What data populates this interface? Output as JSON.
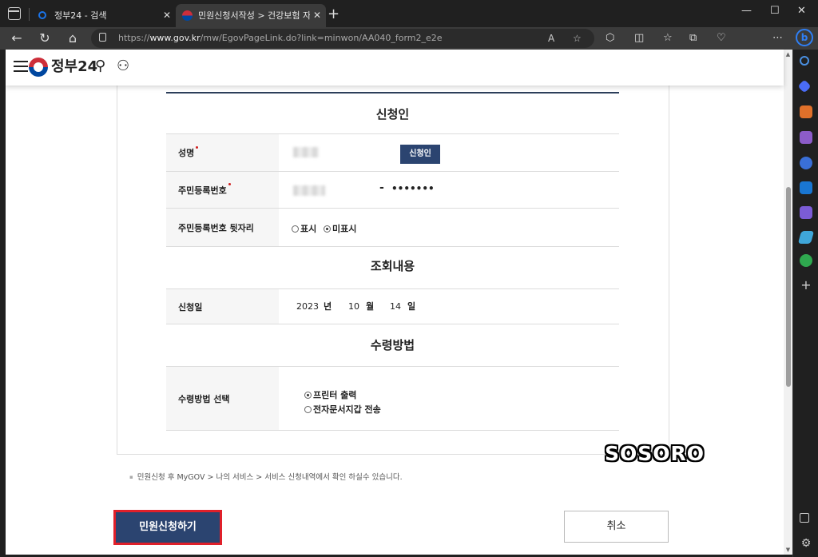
{
  "browser": {
    "tabs": [
      {
        "label": "정부24 - 검색",
        "favicon_color": "#1a73e8"
      },
      {
        "label": "민원신청서작성 > 건강보험 자격",
        "favicon_color": "#cd2e3a"
      }
    ],
    "url_prefix": "https://",
    "url_domain": "www.gov.kr",
    "url_path": "/mw/EgovPageLink.do?link=minwon/AA040_form2_e2e"
  },
  "site": {
    "logo_text": "정부24"
  },
  "form": {
    "applicant_section_title": "신청인",
    "name_label": "성명",
    "applicant_button": "신청인",
    "resident_no_label": "주민등록번호",
    "resident_no_dash": "-",
    "resident_no_masked": "•••••••",
    "back_digits_label": "주민등록번호 뒷자리",
    "show_option": "표시",
    "hide_option": "미표시",
    "hide_selected": true,
    "query_section_title": "조회내용",
    "apply_date_label": "신청일",
    "date_year": "2023",
    "date_year_unit": "년",
    "date_month": "10",
    "date_month_unit": "월",
    "date_day": "14",
    "date_day_unit": "일",
    "receive_section_title": "수령방법",
    "receive_method_label": "수령방법 선택",
    "option_printer": "프린터 출력",
    "option_wallet": "전자문서지갑 전송",
    "printer_selected": true
  },
  "notice": "민원신청 후 MyGOV > 나의 서비스 > 서비스 신청내역에서 확인 하실수 있습니다.",
  "buttons": {
    "submit": "민원신청하기",
    "cancel": "취소"
  },
  "watermark": "SOSORO",
  "colors": {
    "primary_navy": "#2b4470",
    "highlight_red": "#e0202a",
    "required_dot": "#d02020"
  }
}
